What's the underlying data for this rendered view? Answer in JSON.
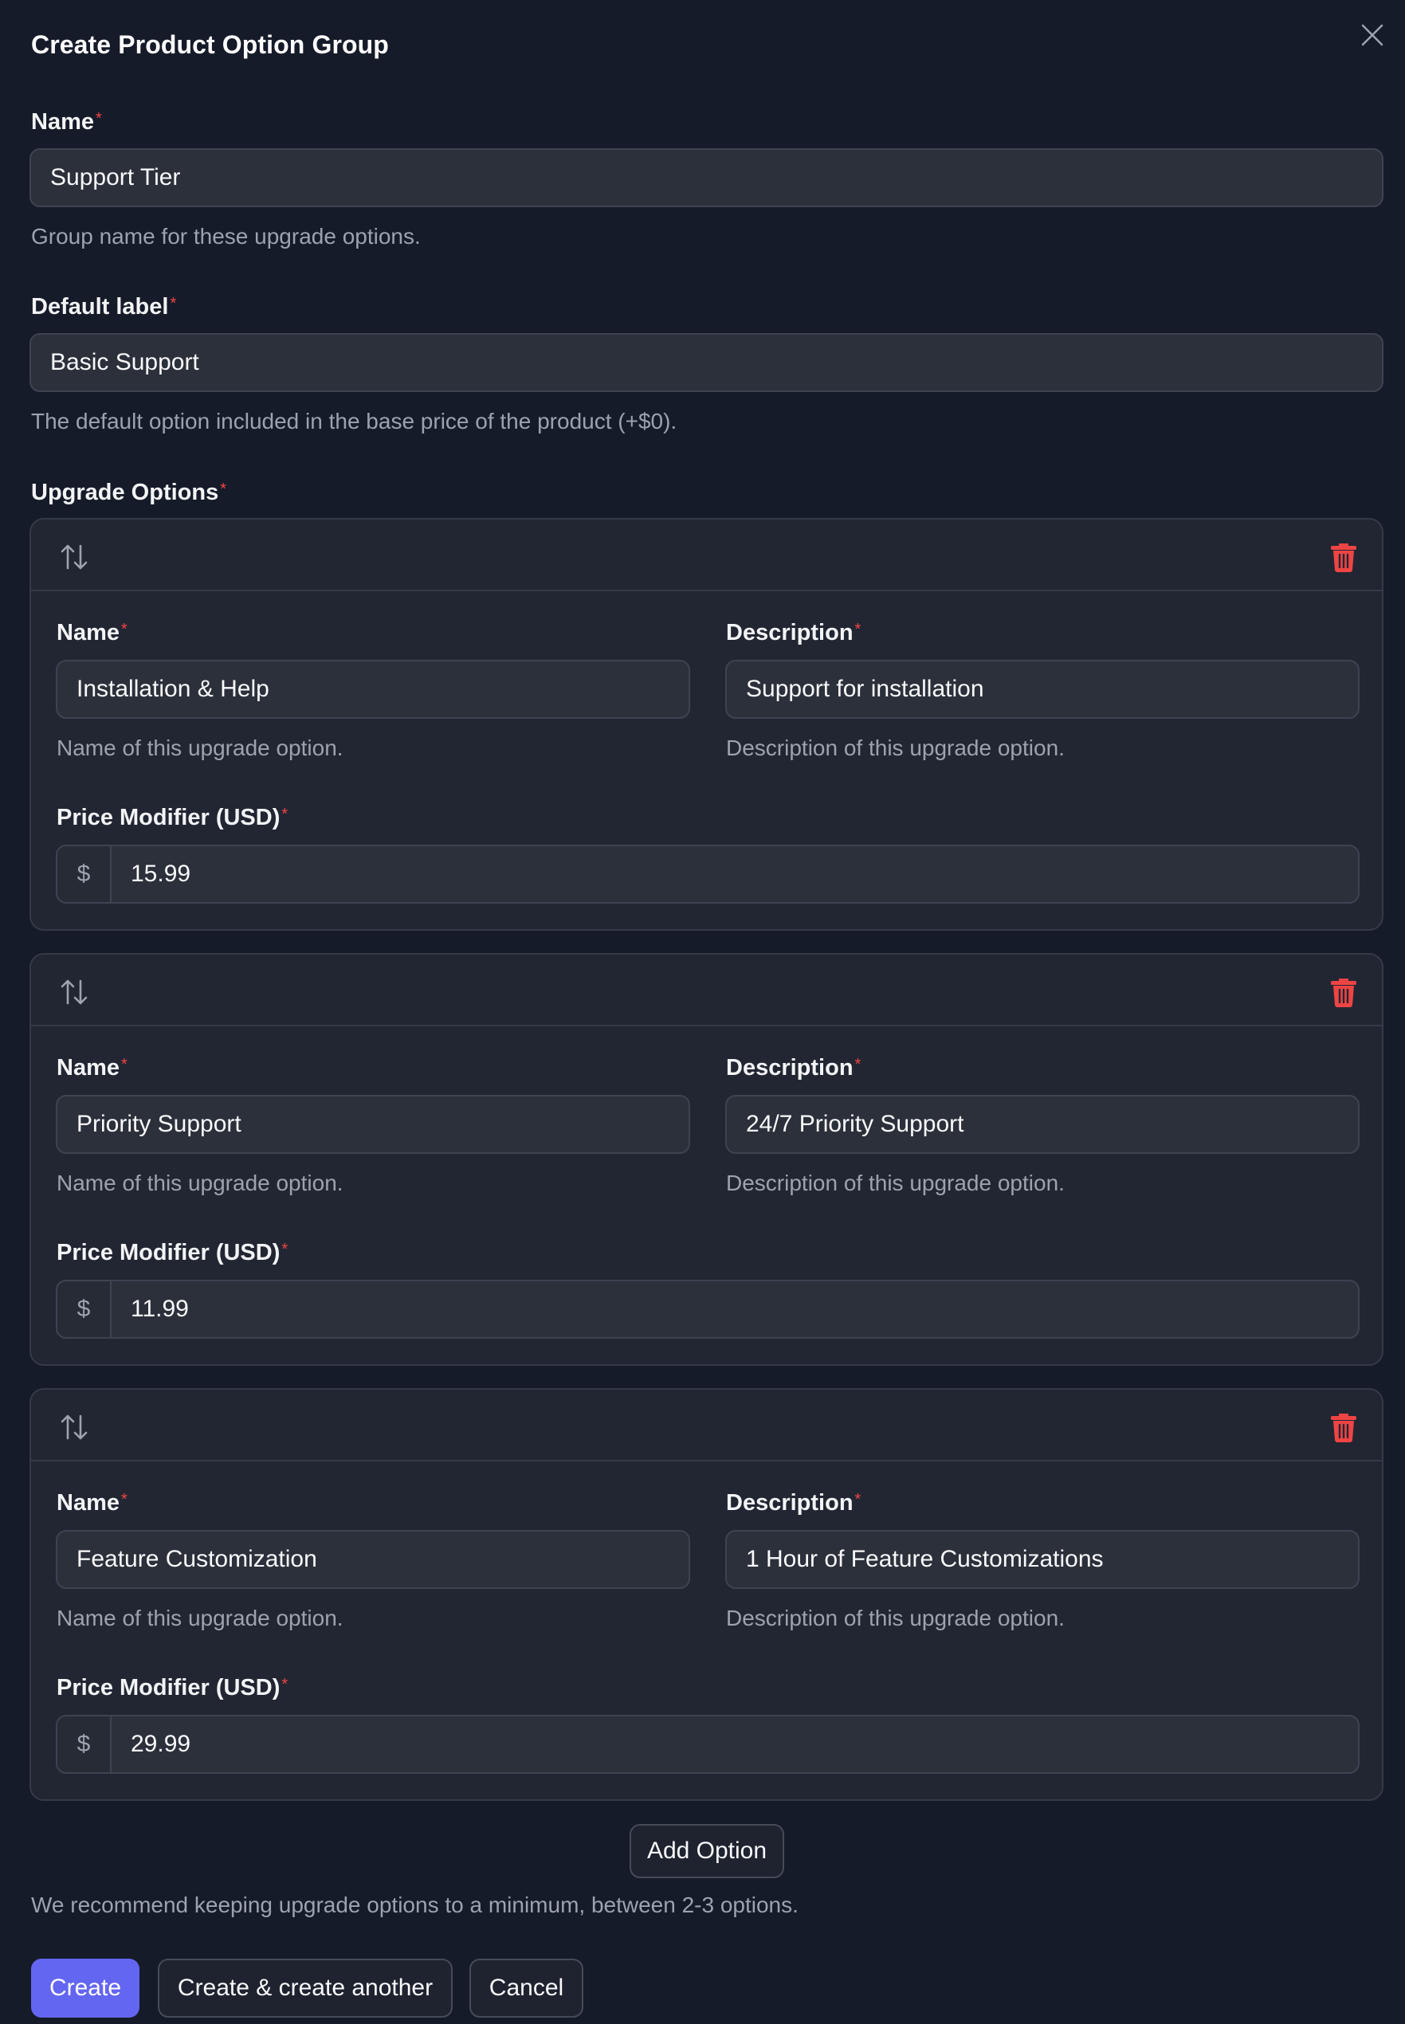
{
  "modal": {
    "title": "Create Product Option Group",
    "required_marker": "*"
  },
  "name_field": {
    "label": "Name",
    "value": "Support Tier",
    "help": "Group name for these upgrade options."
  },
  "default_label_field": {
    "label": "Default label",
    "value": "Basic Support",
    "help": "The default option included in the base price of the product (+$0)."
  },
  "upgrade_options": {
    "label": "Upgrade Options",
    "option_name_label": "Name",
    "option_name_help": "Name of this upgrade option.",
    "option_description_label": "Description",
    "option_description_help": "Description of this upgrade option.",
    "price_label": "Price Modifier (USD)",
    "currency_prefix": "$",
    "items": [
      {
        "name": "Installation & Help",
        "description": "Support for installation",
        "price": "15.99"
      },
      {
        "name": "Priority Support",
        "description": "24/7 Priority Support",
        "price": "11.99"
      },
      {
        "name": "Feature Customization",
        "description": "1 Hour of Feature Customizations",
        "price": "29.99"
      }
    ],
    "add_button": "Add Option",
    "recommendation": "We recommend keeping upgrade options to a minimum, between 2-3 options."
  },
  "footer": {
    "create": "Create",
    "create_another": "Create & create another",
    "cancel": "Cancel"
  },
  "colors": {
    "background": "#161b29",
    "card": "#222632",
    "input": "#2c303b",
    "primary": "#6366f1",
    "danger": "#ef4444",
    "muted_text": "#9ca3af"
  },
  "icons": {
    "close": "close-icon",
    "reorder": "arrows-up-down-icon",
    "delete": "trash-icon"
  }
}
